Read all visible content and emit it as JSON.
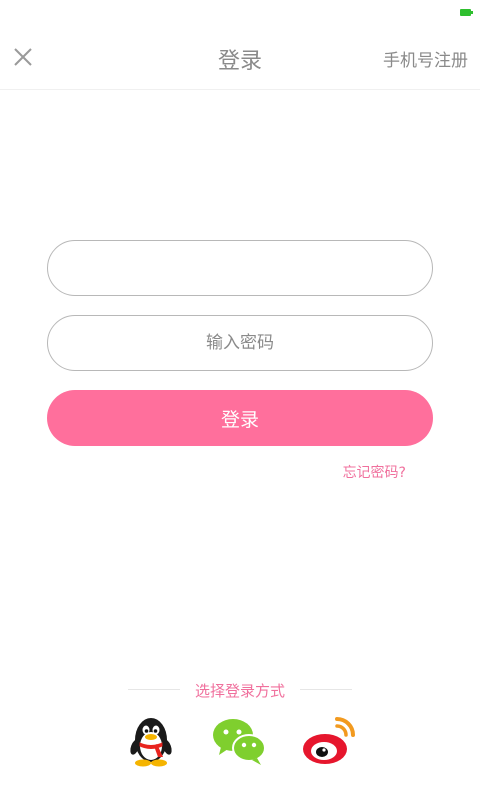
{
  "header": {
    "title": "登录",
    "register_label": "手机号注册",
    "close_icon": "close-icon"
  },
  "form": {
    "account_value": "",
    "account_placeholder": "",
    "password_placeholder": "输入密码",
    "login_label": "登录",
    "forgot_label": "忘记密码?"
  },
  "social": {
    "section_label": "选择登录方式",
    "providers": [
      {
        "name": "QQ",
        "icon": "qq-penguin-icon"
      },
      {
        "name": "WeChat",
        "icon": "wechat-icon"
      },
      {
        "name": "Weibo",
        "icon": "weibo-icon"
      }
    ]
  },
  "colors": {
    "accent": "#ff6f9c",
    "accent_text": "#f0709d",
    "muted_text": "#8a8a8a",
    "battery": "#2fbf2f"
  }
}
